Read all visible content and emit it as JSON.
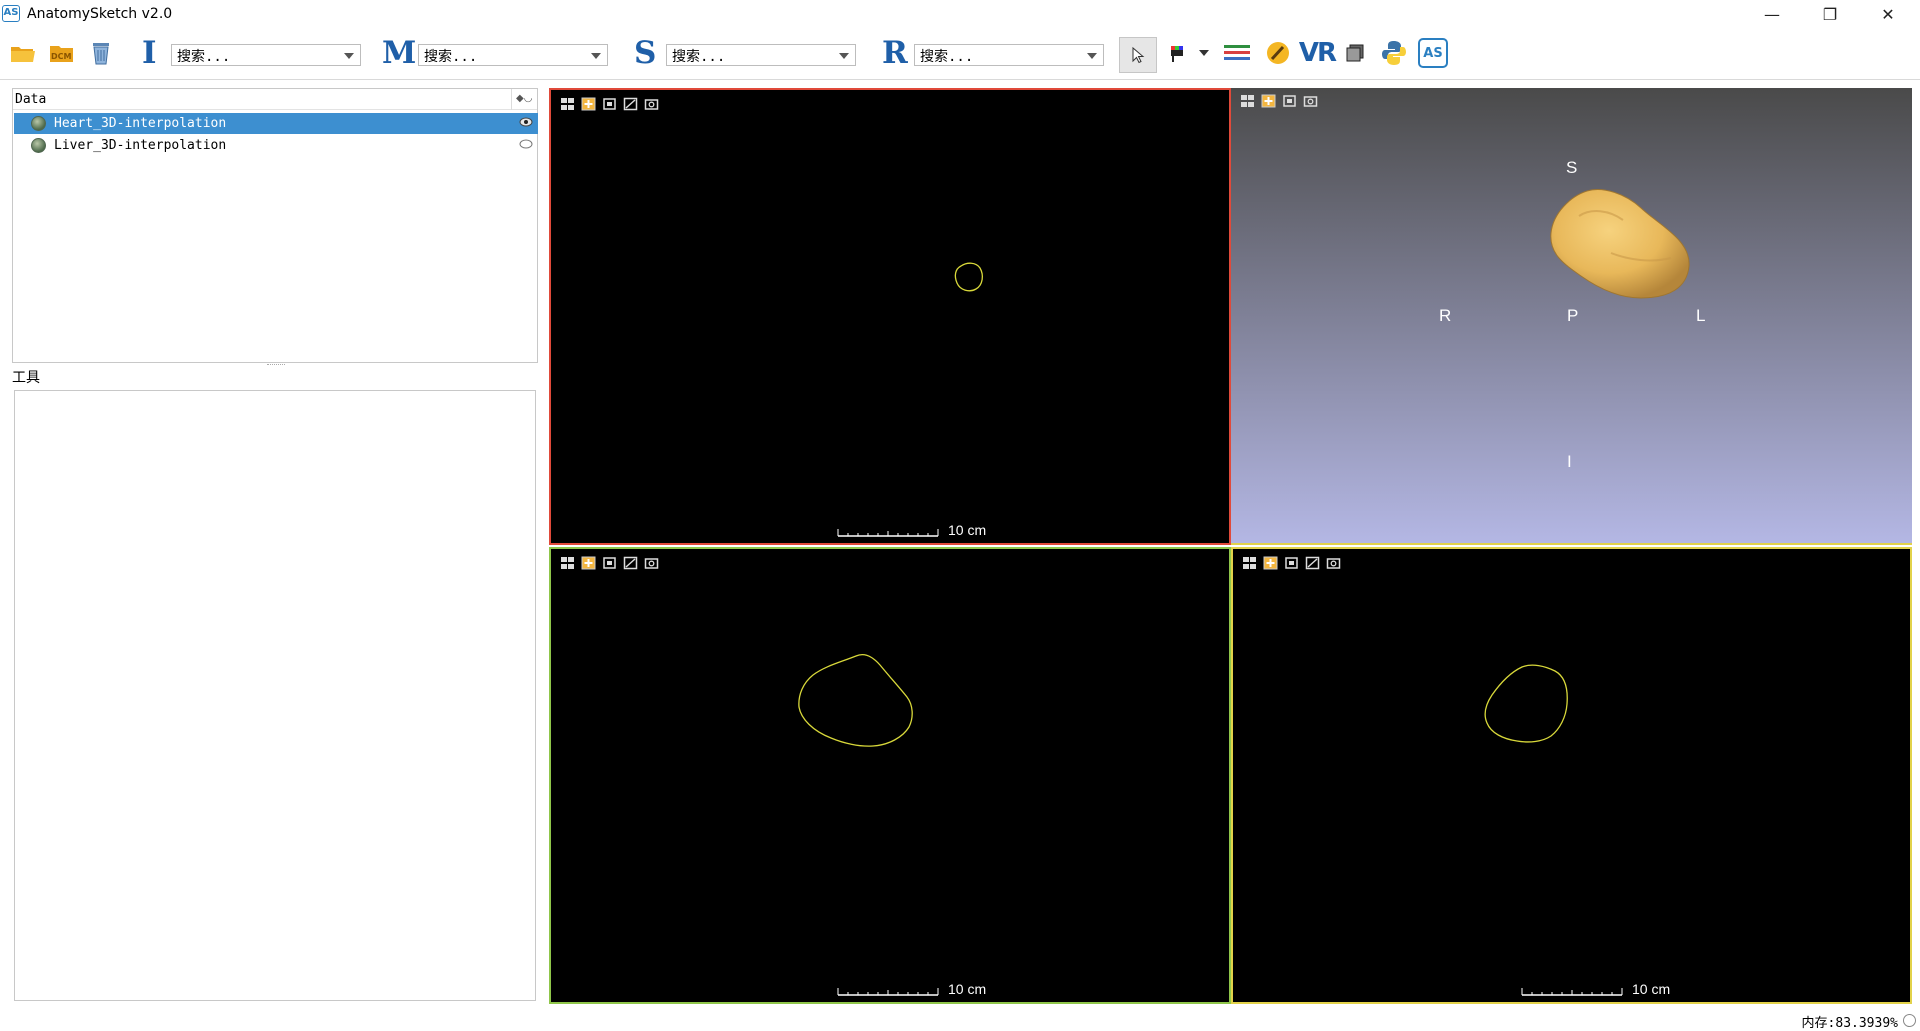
{
  "window": {
    "app_icon_text": "AS",
    "title": "AnatomySketch v2.0",
    "controls": {
      "minimize": "—",
      "restore": "❐",
      "close": "✕"
    }
  },
  "toolbar": {
    "icons": [
      "open-folder-icon",
      "dicom-icon",
      "recycle-bin-icon"
    ],
    "groups": [
      {
        "letter": "I",
        "placeholder": "搜索..."
      },
      {
        "letter": "M",
        "placeholder": "搜索..."
      },
      {
        "letter": "S",
        "placeholder": "搜索..."
      },
      {
        "letter": "R",
        "placeholder": "搜索..."
      }
    ],
    "right_icons": [
      "pointer-icon",
      "color-map-icon",
      "layers-list-icon",
      "brush-icon",
      "vr-icon",
      "stack-icon",
      "python-icon",
      "as-logo-icon"
    ],
    "vr_text": "VR",
    "as_text": "AS",
    "dicom_text": "DCM"
  },
  "data_panel": {
    "header": "Data",
    "items": [
      {
        "label": "Heart_3D-interpolation",
        "selected": true,
        "visible": true
      },
      {
        "label": "Liver_3D-interpolation",
        "selected": false,
        "visible": false
      }
    ]
  },
  "tools_panel": {
    "label": "工具"
  },
  "viewports": {
    "scale_label": "10 cm",
    "orientation": {
      "superior": "S",
      "inferior": "I",
      "right": "R",
      "left": "L",
      "posterior": "P"
    },
    "colors": {
      "axial_border": "#e04a3a",
      "sagittal_border": "#8fc64a",
      "coronal_border": "#e2d24a",
      "contour": "#d8d83a",
      "model": "#e8b85a",
      "background_3d_top": "#4a4a4a",
      "background_3d_bottom": "#b4b7e4"
    }
  },
  "status": {
    "memory": "内存:83.3939%"
  }
}
